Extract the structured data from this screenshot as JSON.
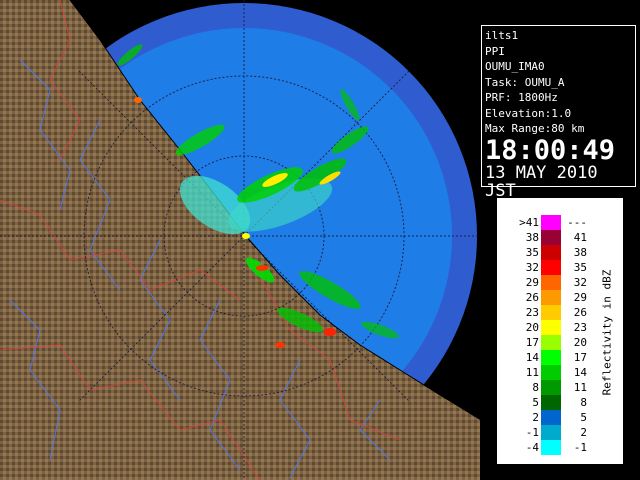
{
  "info": {
    "lines": [
      "ilts1",
      "PPI",
      "OUMU_IMA0",
      "Task: OUMU_A",
      "PRF: 1800Hz",
      "Elevation:1.0",
      "Max Range:80 km"
    ],
    "time": "18:00:49",
    "date": "13 MAY 2010 JST"
  },
  "legend": {
    "title": "Reflectivity in dBZ",
    "rows": [
      {
        "low": ">41",
        "high": "---",
        "color": "#ff00ff"
      },
      {
        "low": "38",
        "high": "41",
        "color": "#990033"
      },
      {
        "low": "35",
        "high": "38",
        "color": "#cc0000"
      },
      {
        "low": "32",
        "high": "35",
        "color": "#ff0000"
      },
      {
        "low": "29",
        "high": "32",
        "color": "#ff6600"
      },
      {
        "low": "26",
        "high": "29",
        "color": "#ff9900"
      },
      {
        "low": "23",
        "high": "26",
        "color": "#ffcc00"
      },
      {
        "low": "20",
        "high": "23",
        "color": "#ffff00"
      },
      {
        "low": "17",
        "high": "20",
        "color": "#99ff00"
      },
      {
        "low": "14",
        "high": "17",
        "color": "#00ff00"
      },
      {
        "low": "11",
        "high": "14",
        "color": "#00cc00"
      },
      {
        "low": "8",
        "high": "11",
        "color": "#009900"
      },
      {
        "low": "5",
        "high": "8",
        "color": "#006600"
      },
      {
        "low": "2",
        "high": "5",
        "color": "#0066cc"
      },
      {
        "low": "-1",
        "high": "2",
        "color": "#00aacc"
      },
      {
        "low": "-4",
        "high": "-1",
        "color": "#00ffff"
      }
    ]
  },
  "colors": {
    "range_disk": "#1e78e6",
    "range_disk_outer": "#2a5fd0",
    "land": "#7a6040",
    "background": "#000000"
  }
}
